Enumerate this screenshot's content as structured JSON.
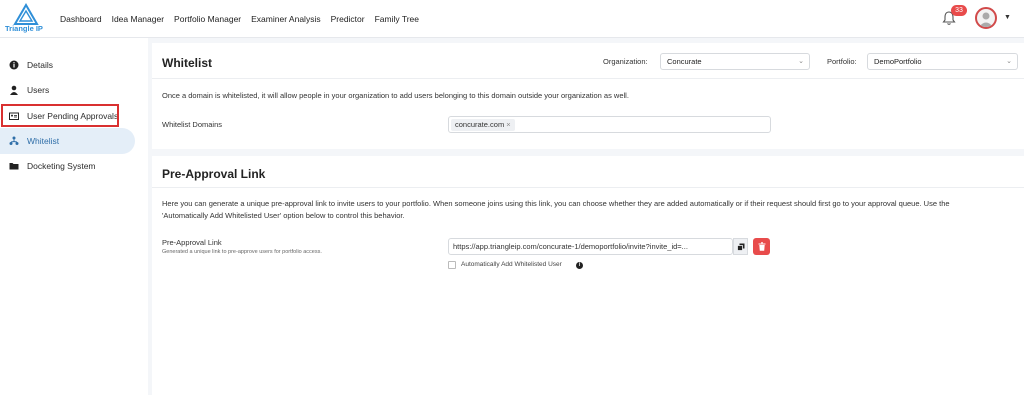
{
  "app": {
    "logo_text": "Triangle IP",
    "brand_color": "#2f8fd8"
  },
  "nav": {
    "items": [
      "Dashboard",
      "Idea Manager",
      "Portfolio Manager",
      "Examiner Analysis",
      "Predictor",
      "Family Tree"
    ]
  },
  "header": {
    "notification_count": "33"
  },
  "sidebar": {
    "items": [
      {
        "label": "Details",
        "icon": "info-icon"
      },
      {
        "label": "Users",
        "icon": "user-icon"
      },
      {
        "label": "User Pending Approvals",
        "icon": "id-card-icon"
      },
      {
        "label": "Whitelist",
        "icon": "network-icon"
      },
      {
        "label": "Docketing System",
        "icon": "folder-icon"
      }
    ],
    "active_index": 3
  },
  "whitelist": {
    "title": "Whitelist",
    "organization_label": "Organization:",
    "organization_value": "Concurate",
    "portfolio_label": "Portfolio:",
    "portfolio_value": "DemoPortfolio",
    "description": "Once a domain is whitelisted, it will allow people in your organization to add users belonging to this domain outside your organization as well.",
    "domains_label": "Whitelist Domains",
    "domains": [
      "concurate.com"
    ]
  },
  "pre_approval": {
    "title": "Pre-Approval Link",
    "description_line1": "Here you can generate a unique pre-approval link to invite users to your portfolio. When someone joins using this link, you can choose whether they are added automatically or if their request should first go to your approval queue. Use the",
    "description_line2": "'Automatically Add Whitelisted User' option below to control this behavior.",
    "link_label": "Pre-Approval Link",
    "link_sublabel": "Generated a unique link to pre-approve users for portfolio access.",
    "link_value": "https://app.triangleip.com/concurate-1/demoportfolio/invite?invite_id=...",
    "auto_add_label": "Automatically Add Whitelisted User"
  }
}
